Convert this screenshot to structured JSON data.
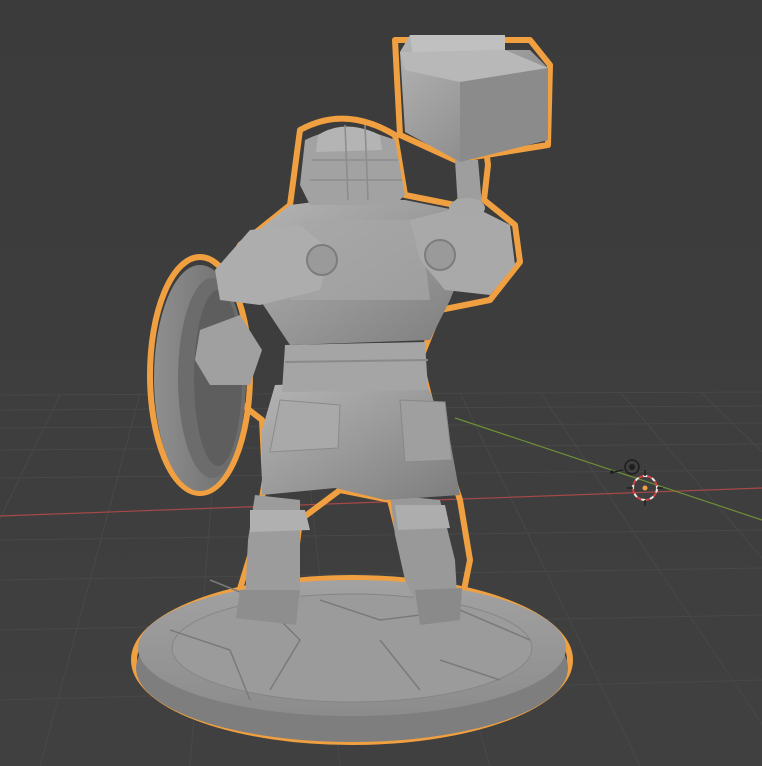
{
  "viewport": {
    "background": "#3d3d3d",
    "grid_color": "#4a4a4a",
    "x_axis_color": "#b04a4a",
    "y_axis_color": "#7a9a3a",
    "selection_outline_color": "#f0a040",
    "mesh_color": "#9a9a9a"
  },
  "scene": {
    "selected_object_icon": "selection-outline",
    "gizmos": [
      "3d-cursor-icon",
      "light-gizmo-icon"
    ]
  }
}
